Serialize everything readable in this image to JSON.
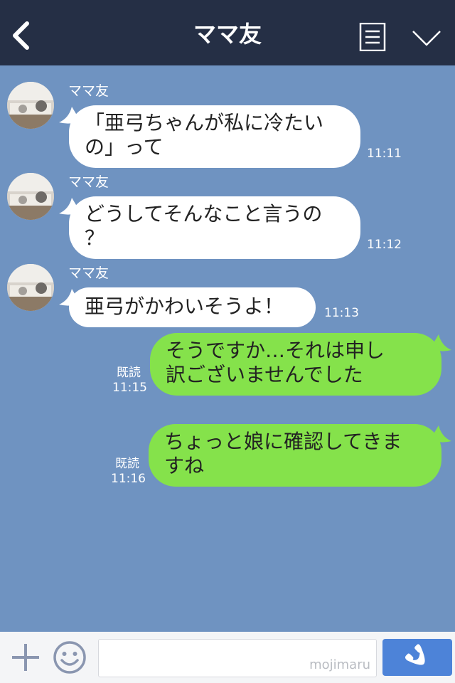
{
  "header": {
    "title": "ママ友",
    "back_icon": "chevron-left-icon",
    "menu_icon": "menu-icon",
    "dropdown_icon": "chevron-down-icon"
  },
  "messages": [
    {
      "direction": "in",
      "sender": "ママ友",
      "text": "「亜弓ちゃんが私に冷たい\nの」って",
      "time": "11:11"
    },
    {
      "direction": "in",
      "sender": "ママ友",
      "text": "どうしてそんなこと言うの\n？",
      "time": "11:12"
    },
    {
      "direction": "in",
      "sender": "ママ友",
      "text": "亜弓がかわいそうよ！",
      "time": "11:13"
    },
    {
      "direction": "out",
      "status": "既読",
      "text": "そうですか…それは申し\n訳ございませんでした",
      "time": "11:15"
    },
    {
      "direction": "out",
      "status": "既読",
      "text": "ちょっと娘に確認してきま\nすね",
      "time": "11:16"
    }
  ],
  "input_bar": {
    "plus_icon": "plus-icon",
    "emoji_icon": "smiley-icon",
    "input_value": "",
    "watermark": "mojimaru",
    "call_icon": "phone-icon"
  },
  "colors": {
    "header_bg": "#252f45",
    "chat_bg": "#6f93c1",
    "incoming_bubble": "#ffffff",
    "outgoing_bubble": "#85e24b",
    "call_button": "#4d83d8"
  }
}
